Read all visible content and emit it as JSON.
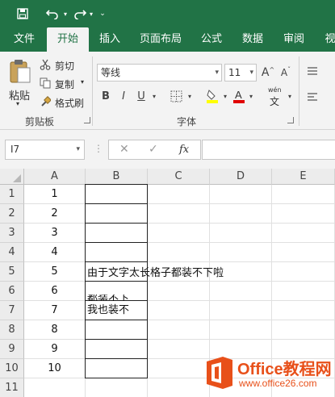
{
  "qat": {
    "save_icon": "save-icon",
    "undo_icon": "undo-icon",
    "redo_icon": "redo-icon",
    "customize_icon": "chevron-down-icon"
  },
  "tabs": [
    {
      "label": "文件"
    },
    {
      "label": "开始"
    },
    {
      "label": "插入"
    },
    {
      "label": "页面布局"
    },
    {
      "label": "公式"
    },
    {
      "label": "数据"
    },
    {
      "label": "审阅"
    },
    {
      "label": "视"
    }
  ],
  "clipboard": {
    "paste_label": "粘贴",
    "cut_label": "剪切",
    "copy_label": "复制",
    "format_painter_label": "格式刷",
    "group_label": "剪贴板"
  },
  "font": {
    "font_name": "等线",
    "font_size": "11",
    "grow_label": "A",
    "shrink_label": "A",
    "bold_label": "B",
    "italic_label": "I",
    "underline_label": "U",
    "phonetic_label": "wén",
    "phonetic_char": "文",
    "group_label": "字体",
    "font_color": "#e00000",
    "fill_color": "#ffff00"
  },
  "formula_bar": {
    "name_box": "I7",
    "cancel_symbol": "✕",
    "enter_symbol": "✓",
    "fx_symbol": "fx",
    "formula_value": ""
  },
  "grid": {
    "columns": [
      "A",
      "B",
      "C",
      "D",
      "E"
    ],
    "rows": [
      "1",
      "2",
      "3",
      "4",
      "5",
      "6",
      "7",
      "8",
      "9",
      "10",
      "11"
    ],
    "col_a_values": [
      "1",
      "2",
      "3",
      "4",
      "5",
      "6",
      "7",
      "8",
      "9",
      "10",
      ""
    ],
    "b5_text": "由于文字太长格子都装不下啦",
    "b6_text_top": "都装不下",
    "b7_text": "我也装不"
  },
  "watermark": {
    "title": "Office教程网",
    "url": "www.office26.com",
    "logo_color": "#e8501a"
  }
}
